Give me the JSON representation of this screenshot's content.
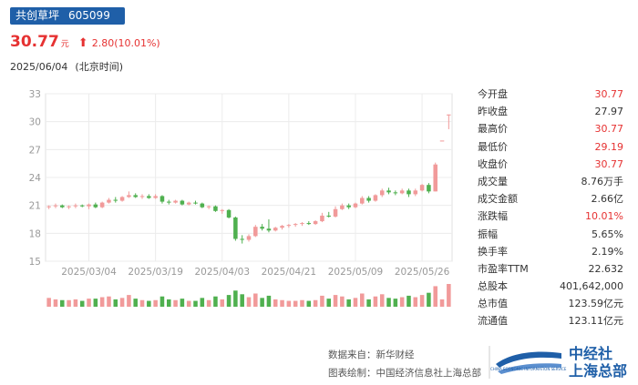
{
  "header": {
    "name": "共创草坪",
    "code": "605099",
    "price": "30.77",
    "unit": "元",
    "arrow": "⬆",
    "change": "2.80(10.01%)",
    "date": "2025/06/04",
    "tz": "(北京时间)"
  },
  "stats": [
    {
      "label": "今开盘",
      "value": "30.77",
      "up": true
    },
    {
      "label": "昨收盘",
      "value": "27.97",
      "up": false
    },
    {
      "label": "最高价",
      "value": "30.77",
      "up": true
    },
    {
      "label": "最低价",
      "value": "29.19",
      "up": true
    },
    {
      "label": "收盘价",
      "value": "30.77",
      "up": true
    },
    {
      "label": "成交量",
      "value": "8.76万手",
      "up": false
    },
    {
      "label": "成交金额",
      "value": "2.66亿",
      "up": false
    },
    {
      "label": "涨跌幅",
      "value": "10.01%",
      "up": true
    },
    {
      "label": "振幅",
      "value": "5.65%",
      "up": false
    },
    {
      "label": "换手率",
      "value": "2.19%",
      "up": false
    },
    {
      "label": "市盈率TTM",
      "value": "22.632",
      "up": false
    },
    {
      "label": "总股本",
      "value": "401,642,000",
      "up": false
    },
    {
      "label": "总市值",
      "value": "123.59亿元",
      "up": false
    },
    {
      "label": "流通值",
      "value": "123.11亿元",
      "up": false
    }
  ],
  "footer": {
    "source": "数据来自：新华财经",
    "maker": "图表绘制：中国经济信息社上海总部",
    "logo_line1": "中经社",
    "logo_line2": "上海总部",
    "logo_small": "CHINA ECONOMIC INFORMATION SERVICE"
  },
  "colors": {
    "up": "#e63232",
    "down": "#2e9b2e",
    "candle_up": "#f19a9a",
    "candle_down": "#4fb04f",
    "brand": "#1f5fa8"
  },
  "chart_data": {
    "type": "candlestick",
    "ylim": [
      15,
      33
    ],
    "yticks": [
      15,
      18,
      21,
      24,
      27,
      30,
      33
    ],
    "xtick_labels": [
      "2025/03/04",
      "2025/03/19",
      "2025/04/03",
      "2025/04/21",
      "2025/05/09",
      "2025/05/26"
    ],
    "xtick_index": [
      6,
      16,
      26,
      36,
      46,
      56
    ],
    "grid": true,
    "candles": [
      [
        20.8,
        21.0,
        20.6,
        20.9,
        1.2
      ],
      [
        20.9,
        21.2,
        20.7,
        21.0,
        1.0
      ],
      [
        21.0,
        21.1,
        20.7,
        20.8,
        0.9
      ],
      [
        20.8,
        21.0,
        20.6,
        20.9,
        0.9
      ],
      [
        20.9,
        21.2,
        20.7,
        21.0,
        1.0
      ],
      [
        21.0,
        21.1,
        20.8,
        20.9,
        0.8
      ],
      [
        20.9,
        21.2,
        20.6,
        21.1,
        1.1
      ],
      [
        21.1,
        21.3,
        20.7,
        20.8,
        1.1
      ],
      [
        20.8,
        21.4,
        20.7,
        21.3,
        1.3
      ],
      [
        21.3,
        21.8,
        21.2,
        21.6,
        1.4
      ],
      [
        21.6,
        21.9,
        21.3,
        21.5,
        1.0
      ],
      [
        21.5,
        22.0,
        21.4,
        21.9,
        1.2
      ],
      [
        21.9,
        22.5,
        21.8,
        22.1,
        1.6
      ],
      [
        22.1,
        22.3,
        21.8,
        21.9,
        1.1
      ],
      [
        21.9,
        22.2,
        21.7,
        22.0,
        0.9
      ],
      [
        22.0,
        22.2,
        21.7,
        21.8,
        0.8
      ],
      [
        21.8,
        22.2,
        21.7,
        22.0,
        0.9
      ],
      [
        22.0,
        22.1,
        21.2,
        21.4,
        1.4
      ],
      [
        21.4,
        21.6,
        21.1,
        21.3,
        1.0
      ],
      [
        21.3,
        21.6,
        21.2,
        21.5,
        0.9
      ],
      [
        21.5,
        21.6,
        21.0,
        21.1,
        1.1
      ],
      [
        21.1,
        21.4,
        21.0,
        21.3,
        0.8
      ],
      [
        21.3,
        21.5,
        21.1,
        21.2,
        0.8
      ],
      [
        21.2,
        21.3,
        20.7,
        20.8,
        1.2
      ],
      [
        20.8,
        21.0,
        20.6,
        20.9,
        0.9
      ],
      [
        20.9,
        21.0,
        20.3,
        20.4,
        1.4
      ],
      [
        20.4,
        20.6,
        20.1,
        20.5,
        1.0
      ],
      [
        20.5,
        20.6,
        19.6,
        19.7,
        1.6
      ],
      [
        19.7,
        19.8,
        17.2,
        17.4,
        2.2
      ],
      [
        17.4,
        17.8,
        16.9,
        17.3,
        1.7
      ],
      [
        17.3,
        17.9,
        17.1,
        17.7,
        1.3
      ],
      [
        17.7,
        18.9,
        17.6,
        18.7,
        1.8
      ],
      [
        18.7,
        19.0,
        18.3,
        18.5,
        1.2
      ],
      [
        18.5,
        19.5,
        18.1,
        18.3,
        1.5
      ],
      [
        18.3,
        18.7,
        18.2,
        18.6,
        1.0
      ],
      [
        18.6,
        18.9,
        18.4,
        18.8,
        0.9
      ],
      [
        18.8,
        19.0,
        18.6,
        18.9,
        0.8
      ],
      [
        18.9,
        19.1,
        18.7,
        19.0,
        0.8
      ],
      [
        19.0,
        19.2,
        18.8,
        19.1,
        0.9
      ],
      [
        19.1,
        19.3,
        18.9,
        19.0,
        0.8
      ],
      [
        19.0,
        19.4,
        18.9,
        19.3,
        0.9
      ],
      [
        19.3,
        20.2,
        19.2,
        19.9,
        1.5
      ],
      [
        19.9,
        20.3,
        19.7,
        19.8,
        1.1
      ],
      [
        19.8,
        20.9,
        19.7,
        20.6,
        1.6
      ],
      [
        20.6,
        21.2,
        20.5,
        21.0,
        1.4
      ],
      [
        21.0,
        21.2,
        20.6,
        20.8,
        1.0
      ],
      [
        20.8,
        21.3,
        20.7,
        21.2,
        1.2
      ],
      [
        21.2,
        22.0,
        21.1,
        21.8,
        1.8
      ],
      [
        21.8,
        22.0,
        21.3,
        21.5,
        1.0
      ],
      [
        21.5,
        22.2,
        21.4,
        22.1,
        1.4
      ],
      [
        22.1,
        22.8,
        21.9,
        22.6,
        1.7
      ],
      [
        22.6,
        22.9,
        22.2,
        22.4,
        1.2
      ],
      [
        22.4,
        22.6,
        22.1,
        22.3,
        1.1
      ],
      [
        22.3,
        22.8,
        22.2,
        22.6,
        1.3
      ],
      [
        22.6,
        22.8,
        21.9,
        22.2,
        1.5
      ],
      [
        22.2,
        22.8,
        22.0,
        22.6,
        1.3
      ],
      [
        22.6,
        23.3,
        22.5,
        23.2,
        1.6
      ],
      [
        23.2,
        23.4,
        22.3,
        22.5,
        1.9
      ],
      [
        22.5,
        25.6,
        22.5,
        25.4,
        2.8
      ],
      [
        27.97,
        27.97,
        27.97,
        27.97,
        1.0
      ],
      [
        30.77,
        30.77,
        29.19,
        30.77,
        3.1
      ]
    ]
  }
}
